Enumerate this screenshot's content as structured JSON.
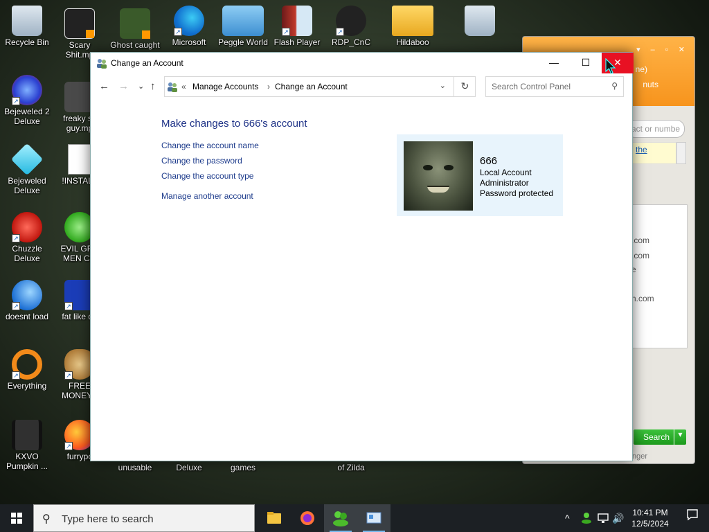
{
  "desktop": {
    "icons": [
      {
        "label": "Recycle Bin"
      },
      {
        "label": "Scary\nShit.mp"
      },
      {
        "label": "Ghost caught"
      },
      {
        "label": "Microsoft"
      },
      {
        "label": "Peggle World"
      },
      {
        "label": "Flash Player"
      },
      {
        "label": "RDP_CnC"
      },
      {
        "label": "Hildaboo"
      },
      {
        "label": "Bejeweled 2\nDeluxe"
      },
      {
        "label": "freaky sc\nguy.mp"
      },
      {
        "label": "Bejeweled\nDeluxe"
      },
      {
        "label": "!INSTALL"
      },
      {
        "label": "Chuzzle\nDeluxe"
      },
      {
        "label": "EVIL GRE\nMEN CO"
      },
      {
        "label": "doesnt load"
      },
      {
        "label": "fat like da"
      },
      {
        "label": "Everything"
      },
      {
        "label": "FREE\nMONEY.c"
      },
      {
        "label": "KXVO\nPumpkin ..."
      },
      {
        "label": "furrypc"
      },
      {
        "label": "unusable"
      },
      {
        "label": "Deluxe"
      },
      {
        "label": "games"
      },
      {
        "label": "of Zilda"
      }
    ]
  },
  "background_window": {
    "header_line1": "ne)",
    "header_line2": "nuts",
    "search_placeholder": "act or numbe",
    "note_link": "the",
    "list_items": [
      ".com",
      ".com",
      "e",
      "n.com"
    ],
    "search_button": "Search",
    "footer": "nger"
  },
  "window": {
    "title": "Change an Account",
    "minimize": "—",
    "maximize": "☐",
    "close": "✕"
  },
  "nav": {
    "back": "←",
    "forward": "→",
    "recent": "⌄",
    "up": "↑",
    "crumb_sep_start": "«",
    "breadcrumb": [
      "Manage Accounts",
      "Change an Account"
    ],
    "crumb_sep": "›",
    "dropdown": "⌄",
    "refresh": "↻",
    "search_placeholder": "Search Control Panel",
    "search_icon": "⚲"
  },
  "main": {
    "heading": "Make changes to 666's account",
    "links": [
      "Change the account name",
      "Change the password",
      "Change the account type",
      "Manage another account"
    ],
    "account": {
      "name": "666",
      "type": "Local Account",
      "role": "Administrator",
      "status": "Password protected"
    }
  },
  "taskbar": {
    "search_placeholder": "Type here to search",
    "time": "10:41 PM",
    "date": "12/5/2024",
    "tray_chevron": "^",
    "tray_volume": "🔊"
  },
  "colors": {
    "link": "#1e3c8c",
    "heading": "#1e3287",
    "close_button": "#e81123",
    "account_panel": "#e8f4fc"
  }
}
